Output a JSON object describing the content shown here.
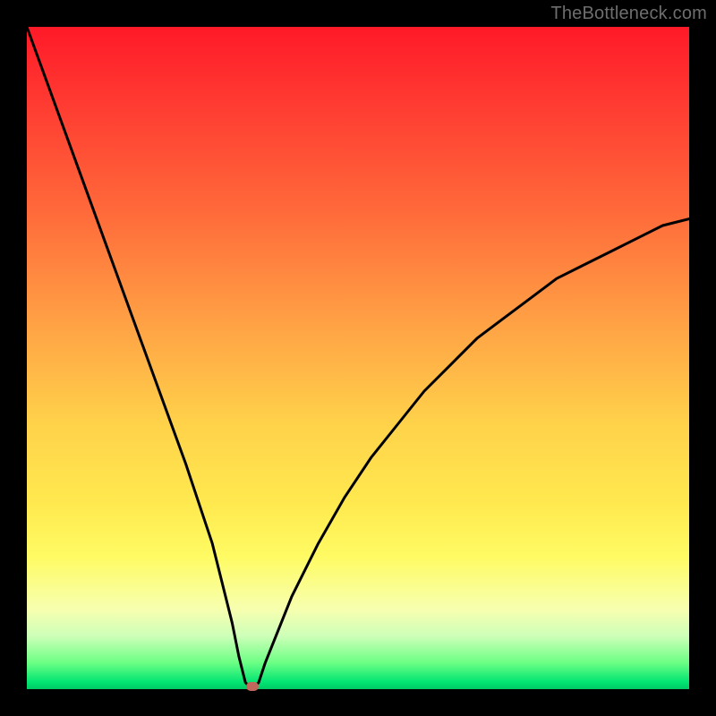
{
  "watermark": "TheBottleneck.com",
  "colors": {
    "frame_bg": "#000000",
    "gradient_top": "#ff1928",
    "gradient_mid1": "#ffa245",
    "gradient_mid2": "#ffe94f",
    "gradient_bottom": "#00c864",
    "curve": "#000000",
    "marker": "#c1675b",
    "watermark_text": "#6e6e6e"
  },
  "chart_data": {
    "type": "line",
    "title": "",
    "xlabel": "",
    "ylabel": "",
    "xlim": [
      0,
      100
    ],
    "ylim": [
      0,
      100
    ],
    "grid": false,
    "legend": false,
    "annotations": [
      {
        "text": "TheBottleneck.com",
        "position": "top-right"
      }
    ],
    "series": [
      {
        "name": "bottleneck-curve",
        "x": [
          0,
          4,
          8,
          12,
          16,
          20,
          24,
          26,
          28,
          30,
          31,
          32,
          33,
          34,
          35,
          36,
          38,
          40,
          44,
          48,
          52,
          56,
          60,
          64,
          68,
          72,
          76,
          80,
          84,
          88,
          92,
          96,
          100
        ],
        "values": [
          100,
          89,
          78,
          67,
          56,
          45,
          34,
          28,
          22,
          14,
          10,
          5,
          1,
          0,
          1,
          4,
          9,
          14,
          22,
          29,
          35,
          40,
          45,
          49,
          53,
          56,
          59,
          62,
          64,
          66,
          68,
          70,
          71
        ]
      }
    ],
    "marker": {
      "x": 34,
      "y": 0
    },
    "floor_segment": {
      "x_start": 31.5,
      "x_end": 34,
      "y": 0
    }
  }
}
